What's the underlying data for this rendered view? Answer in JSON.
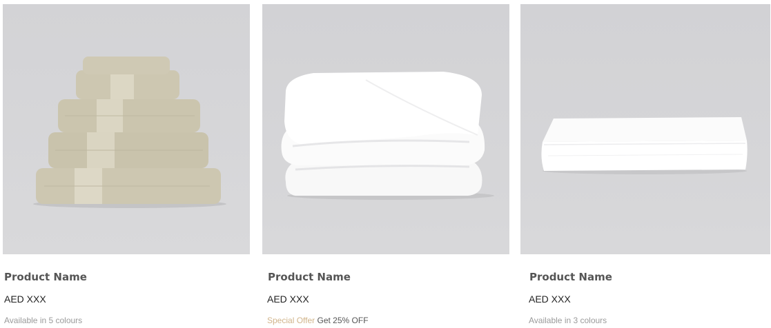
{
  "products": [
    {
      "image_icon": "towel-stack-icon",
      "name": "Product Name",
      "price": "AED XXX",
      "availability": "Available in 5 colours"
    },
    {
      "image_icon": "duvet-icon",
      "name": "Product Name",
      "price": "AED XXX",
      "offer_label": "Special Offer",
      "offer_text": "Get 25% OFF"
    },
    {
      "image_icon": "bed-sheet-icon",
      "name": "Product Name",
      "price": "AED XXX",
      "availability": "Available in 3 colours"
    }
  ],
  "colors": {
    "image_background": "#d6d6d8",
    "towel": "#cfc9b4",
    "linen": "#ffffff",
    "offer_accent": "#d1b48a",
    "product_name": "#555555"
  }
}
